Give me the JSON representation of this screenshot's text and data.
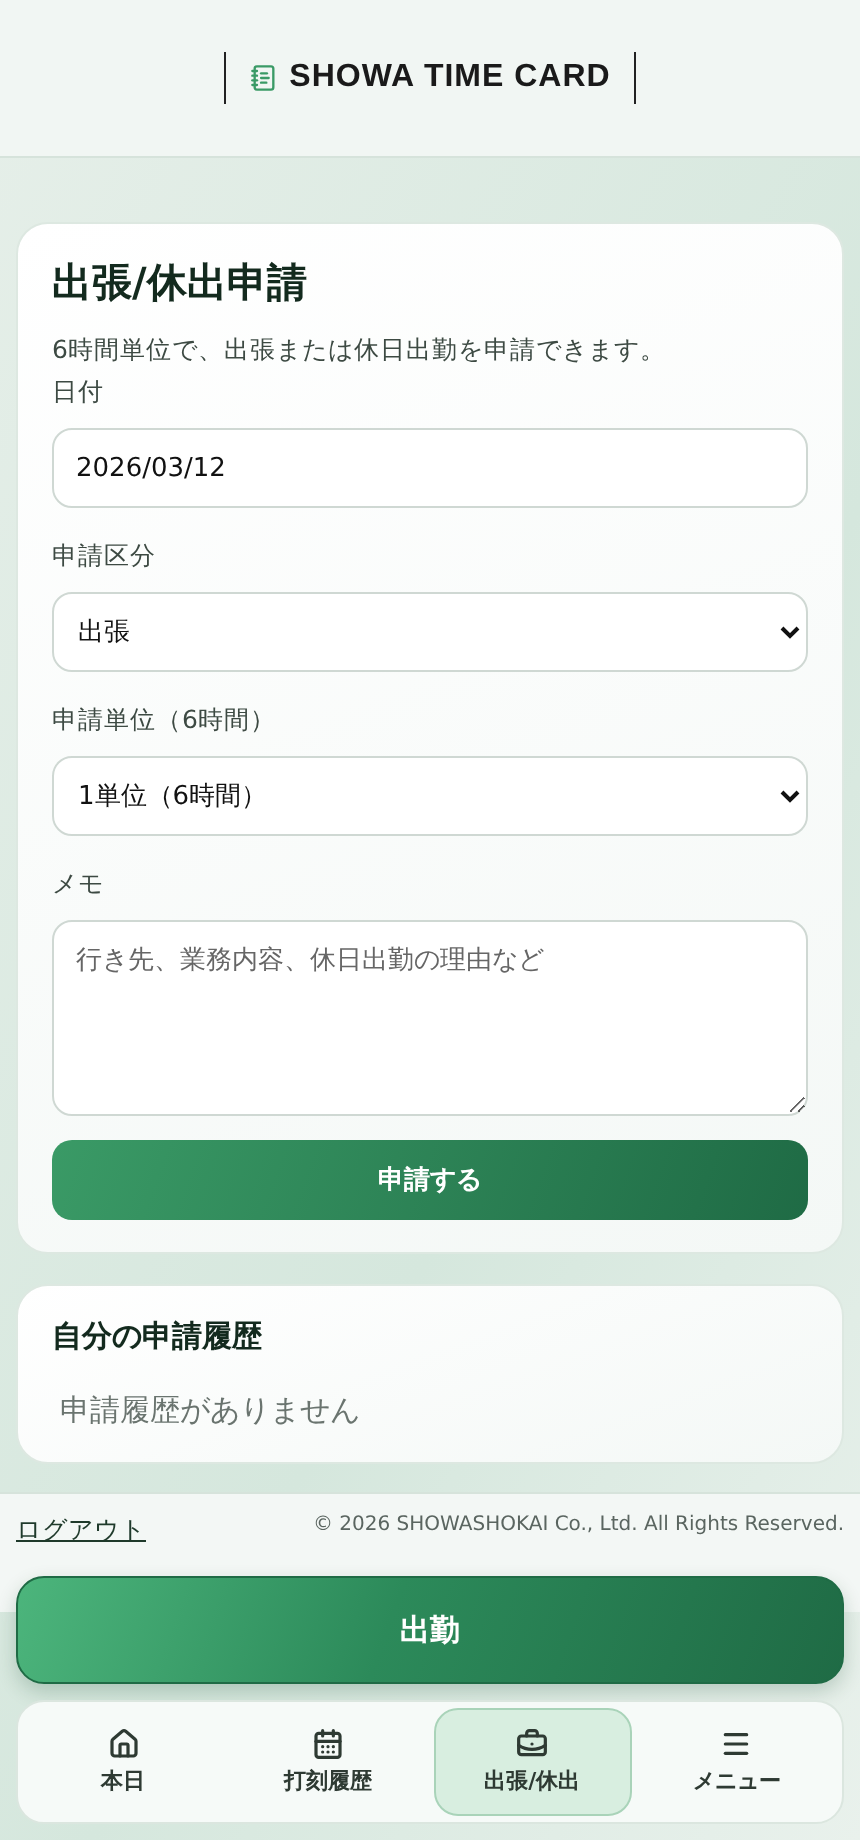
{
  "header": {
    "logo_text": "SHOWA TIME CARD"
  },
  "form": {
    "title": "出張/休出申請",
    "description": "6時間単位で、出張または休日出勤を申請できます。",
    "fields": [
      {
        "kind": "input",
        "label": "日付",
        "value": "2026/03/12"
      },
      {
        "kind": "select",
        "label": "申請区分",
        "value": "出張"
      },
      {
        "kind": "select",
        "label": "申請単位（6時間）",
        "value": "1単位（6時間）"
      },
      {
        "kind": "textarea",
        "label": "メモ",
        "placeholder": "行き先、業務内容、休日出勤の理由など"
      }
    ],
    "submit": "申請する"
  },
  "history": {
    "title": "自分の申請履歴",
    "empty": "申請履歴がありません"
  },
  "footer": {
    "logout": "ログアウト",
    "copyright": "© 2026 SHOWASHOKAI Co., Ltd. All Rights Reserved."
  },
  "clock_button": "出勤",
  "nav": [
    {
      "kind": "home",
      "label": "本日",
      "selected": false
    },
    {
      "kind": "calendar",
      "label": "打刻履歴",
      "selected": false
    },
    {
      "kind": "briefcase",
      "label": "出張/休出",
      "selected": true
    },
    {
      "kind": "menu",
      "label": "メニュー",
      "selected": false
    }
  ]
}
